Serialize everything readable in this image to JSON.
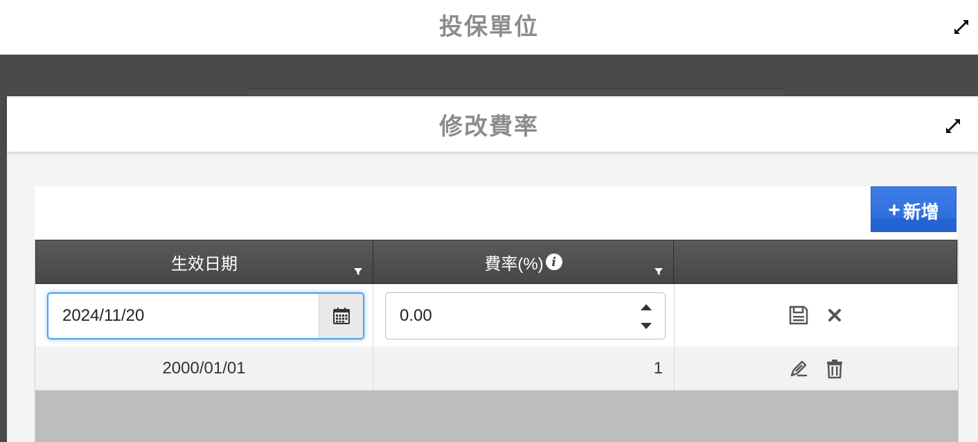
{
  "background_window": {
    "title": "投保單位"
  },
  "dialog": {
    "title": "修改費率",
    "toolbar": {
      "add_label": "新增"
    },
    "grid": {
      "columns": [
        {
          "label": "生效日期",
          "has_filter": true
        },
        {
          "label": "費率(%)",
          "has_filter": true,
          "has_info": true
        },
        {
          "label": ""
        }
      ],
      "edit_row": {
        "date_value": "2024/11/20",
        "rate_value": "0.00"
      },
      "rows": [
        {
          "date": "2000/01/01",
          "rate": "1"
        }
      ]
    }
  },
  "colors": {
    "accent_blue": "#2f6fdc",
    "header_dark": "#4a4a4a",
    "focus_blue": "#4f9fe6"
  }
}
